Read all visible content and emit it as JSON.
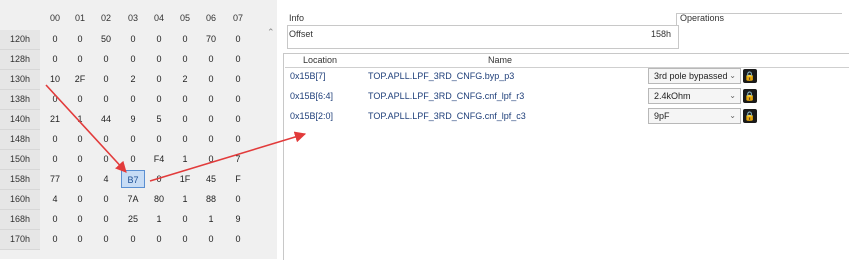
{
  "hex": {
    "columns": [
      "00",
      "01",
      "02",
      "03",
      "04",
      "05",
      "06",
      "07"
    ],
    "rows": [
      {
        "label": "120h",
        "cells": [
          "0",
          "0",
          "50",
          "0",
          "0",
          "0",
          "70",
          "0"
        ]
      },
      {
        "label": "128h",
        "cells": [
          "0",
          "0",
          "0",
          "0",
          "0",
          "0",
          "0",
          "0"
        ]
      },
      {
        "label": "130h",
        "cells": [
          "10",
          "2F",
          "0",
          "2",
          "0",
          "2",
          "0",
          "0"
        ]
      },
      {
        "label": "138h",
        "cells": [
          "0",
          "0",
          "0",
          "0",
          "0",
          "0",
          "0",
          "0"
        ]
      },
      {
        "label": "140h",
        "cells": [
          "21",
          "1",
          "44",
          "9",
          "5",
          "0",
          "0",
          "0"
        ]
      },
      {
        "label": "148h",
        "cells": [
          "0",
          "0",
          "0",
          "0",
          "0",
          "0",
          "0",
          "0"
        ]
      },
      {
        "label": "150h",
        "cells": [
          "0",
          "0",
          "0",
          "0",
          "F4",
          "1",
          "0",
          "7"
        ]
      },
      {
        "label": "158h",
        "cells": [
          "77",
          "0",
          "4",
          "B7",
          "0",
          "1F",
          "45",
          "F"
        ]
      },
      {
        "label": "160h",
        "cells": [
          "4",
          "0",
          "0",
          "7A",
          "80",
          "1",
          "88",
          "0"
        ]
      },
      {
        "label": "168h",
        "cells": [
          "0",
          "0",
          "0",
          "25",
          "1",
          "0",
          "1",
          "9"
        ]
      },
      {
        "label": "170h",
        "cells": [
          "0",
          "0",
          "0",
          "0",
          "0",
          "0",
          "0",
          "0"
        ]
      }
    ],
    "selected": {
      "row": 7,
      "col": 3
    }
  },
  "info": {
    "title": "Info",
    "offset_label": "Offset",
    "offset_value": "158h",
    "operations_label": "Operations"
  },
  "table": {
    "headers": {
      "location": "Location",
      "name": "Name"
    },
    "rows": [
      {
        "location": "0x15B[7]",
        "name": "TOP.APLL.LPF_3RD_CNFG.byp_p3",
        "value": "3rd pole bypassed"
      },
      {
        "location": "0x15B[6:4]",
        "name": "TOP.APLL.LPF_3RD_CNFG.cnf_lpf_r3",
        "value": "2.4kOhm"
      },
      {
        "location": "0x15B[2:0]",
        "name": "TOP.APLL.LPF_3RD_CNFG.cnf_lpf_c3",
        "value": "9pF"
      }
    ]
  },
  "colors": {
    "arrow": "#e23b3b",
    "selection": "#c7dcf5",
    "link_text": "#1f3f7a"
  },
  "icons": {
    "lock": "lock-icon",
    "dropdown": "chevron-down-icon",
    "scroll": "scroll-up-arrow-icon"
  }
}
